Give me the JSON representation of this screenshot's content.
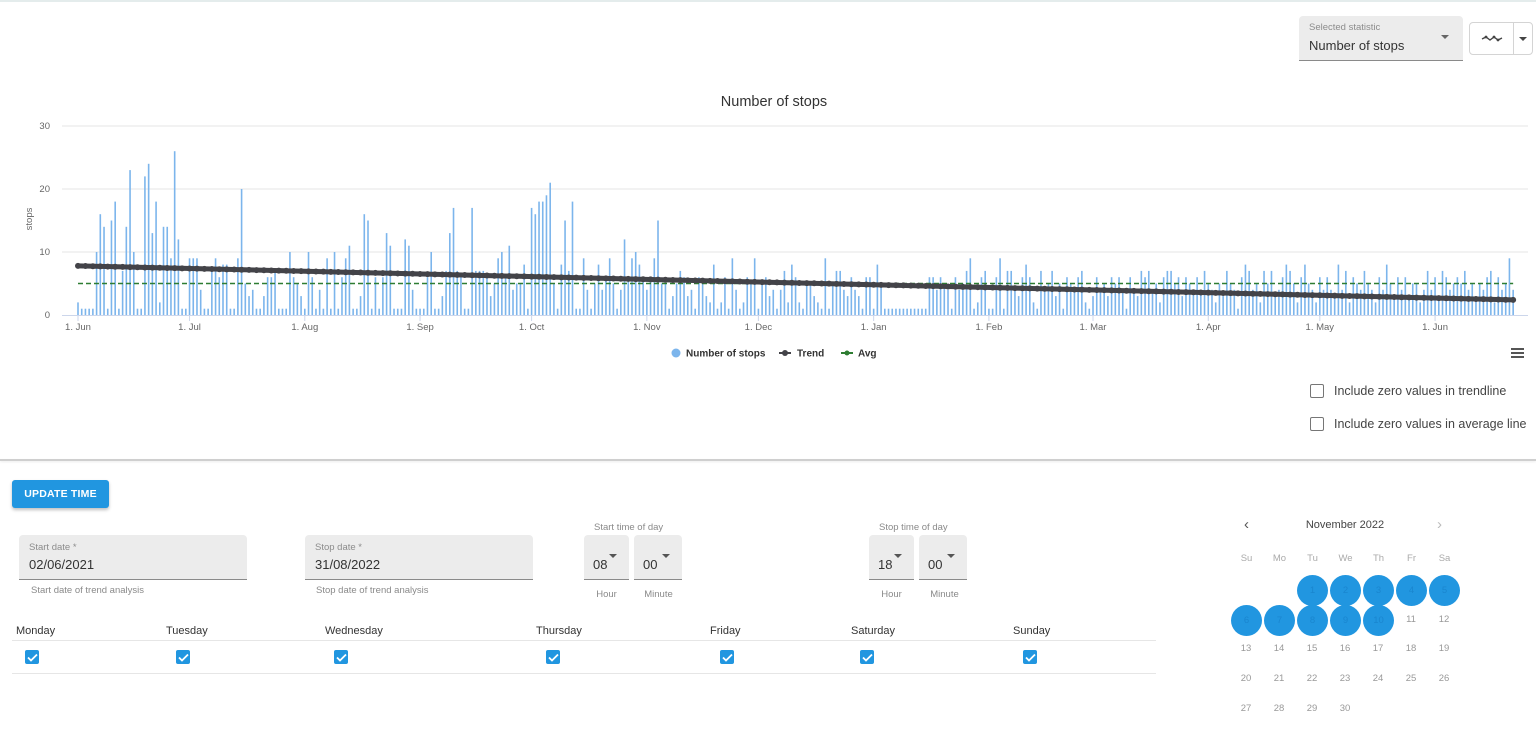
{
  "controls": {
    "statistic_select": {
      "label": "Selected statistic",
      "value": "Number of stops"
    },
    "chart_type_button": {
      "icon": "line-chart-icon"
    },
    "chart_type_dropdown": {
      "icon": "caret-down-icon"
    }
  },
  "chart_data": {
    "type": "bar",
    "title": "Number of stops",
    "xlabel": "",
    "ylabel": "stops",
    "ylim": [
      0,
      30
    ],
    "yticks": [
      0,
      10,
      20,
      30
    ],
    "grid": true,
    "x_start": "2021-06-01",
    "x_end": "2022-06-20",
    "xticks": [
      {
        "label": "1. Jun",
        "day": 0
      },
      {
        "label": "1. Jul",
        "day": 30
      },
      {
        "label": "1. Aug",
        "day": 61
      },
      {
        "label": "1. Sep",
        "day": 92
      },
      {
        "label": "1. Oct",
        "day": 122
      },
      {
        "label": "1. Nov",
        "day": 153
      },
      {
        "label": "1. Dec",
        "day": 183
      },
      {
        "label": "1. Jan",
        "day": 214
      },
      {
        "label": "1. Feb",
        "day": 245
      },
      {
        "label": "1. Mar",
        "day": 273
      },
      {
        "label": "1. Apr",
        "day": 304
      },
      {
        "label": "1. May",
        "day": 334
      },
      {
        "label": "1. Jun",
        "day": 365
      }
    ],
    "legend_position": "bottom-center",
    "series": [
      {
        "name": "Number of stops",
        "type": "bar",
        "color": "#7cb5ec",
        "values": [
          2,
          1,
          1,
          1,
          1,
          10,
          16,
          14,
          1,
          15,
          18,
          1,
          7,
          14,
          23,
          10,
          1,
          1,
          22,
          24,
          13,
          18,
          2,
          14,
          14,
          9,
          26,
          12,
          1,
          1,
          9,
          9,
          9,
          4,
          1,
          1,
          7,
          9,
          6,
          8,
          8,
          1,
          1,
          9,
          20,
          5,
          3,
          4,
          1,
          1,
          3,
          6,
          6,
          7,
          1,
          1,
          1,
          10,
          6,
          5,
          3,
          1,
          10,
          6,
          1,
          4,
          1,
          9,
          1,
          10,
          1,
          6,
          9,
          11,
          1,
          1,
          3,
          16,
          15,
          1,
          6,
          1,
          6,
          13,
          11,
          1,
          1,
          1,
          12,
          11,
          4,
          1,
          1,
          1,
          6,
          10,
          1,
          1,
          3,
          7,
          13,
          17,
          7,
          6,
          1,
          1,
          17,
          7,
          7,
          7,
          6,
          3,
          5,
          9,
          10,
          6,
          11,
          4,
          5,
          5,
          8,
          1,
          17,
          16,
          18,
          18,
          19,
          21,
          5,
          1,
          8,
          15,
          7,
          18,
          1,
          1,
          9,
          4,
          1,
          5,
          8,
          4,
          6,
          9,
          5,
          1,
          4,
          12,
          6,
          9,
          10,
          8,
          6,
          4,
          6,
          9,
          15,
          5,
          5,
          1,
          3,
          5,
          7,
          6,
          3,
          4,
          1,
          6,
          5,
          3,
          2,
          8,
          1,
          2,
          6,
          1,
          9,
          4,
          1,
          2,
          6,
          5,
          9,
          1,
          5,
          6,
          3,
          4,
          1,
          4,
          7,
          2,
          8,
          6,
          2,
          1,
          5,
          5,
          3,
          2,
          1,
          9,
          1,
          5,
          7,
          7,
          4,
          3,
          6,
          4,
          3,
          1,
          6,
          6,
          1,
          8,
          5,
          1,
          1,
          1,
          1,
          1,
          1,
          1,
          1,
          1,
          1,
          1,
          1,
          6,
          6,
          4,
          6,
          5,
          4,
          1,
          6,
          4,
          5,
          7,
          9,
          1,
          2,
          6,
          7,
          1,
          1,
          6,
          9,
          1,
          7,
          7,
          4,
          3,
          6,
          8,
          6,
          2,
          1,
          7,
          4,
          5,
          7,
          3,
          5,
          1,
          6,
          5,
          4,
          6,
          7,
          2,
          1,
          3,
          6,
          4,
          5,
          3,
          6,
          5,
          6,
          4,
          1,
          6,
          4,
          3,
          7,
          6,
          7,
          4,
          5,
          2,
          6,
          7,
          7,
          5,
          6,
          3,
          6,
          5,
          4,
          6,
          4,
          7,
          5,
          4,
          2,
          5,
          3,
          7,
          5,
          4,
          1,
          6,
          8,
          7,
          4,
          5,
          2,
          7,
          5,
          7,
          3,
          4,
          6,
          8,
          7,
          5,
          2,
          6,
          8,
          5,
          4,
          2,
          6,
          4,
          6,
          4,
          3,
          8,
          4,
          7,
          2,
          6,
          5,
          4,
          7,
          5,
          4,
          2,
          6,
          4,
          8,
          5,
          3,
          6,
          4,
          6,
          3,
          5,
          5,
          2,
          4,
          7,
          4,
          6,
          3,
          7,
          6,
          4,
          5,
          6,
          5,
          7,
          4,
          5,
          3,
          5,
          4,
          6,
          7,
          2,
          6,
          4,
          5,
          9,
          4
        ]
      },
      {
        "name": "Trend",
        "type": "line",
        "color": "#434348",
        "start_value": 7.8,
        "end_value": 2.4
      },
      {
        "name": "Avg",
        "type": "line",
        "color": "#2e7d32",
        "dash": "dashed",
        "value": 5
      }
    ]
  },
  "chart_menu": {
    "icon": "hamburger-menu-icon"
  },
  "options": [
    {
      "label": "Include zero values in trendline",
      "checked": false
    },
    {
      "label": "Include zero values in average line",
      "checked": false
    }
  ],
  "update_button": "UPDATE TIME",
  "start_date": {
    "label": "Start date *",
    "value": "02/06/2021",
    "hint": "Start date of trend analysis"
  },
  "stop_date": {
    "label": "Stop date *",
    "value": "31/08/2022",
    "hint": "Stop date of trend analysis"
  },
  "start_time": {
    "label": "Start time of day",
    "hour": "08",
    "minute": "00",
    "hour_label": "Hour",
    "minute_label": "Minute"
  },
  "stop_time": {
    "label": "Stop time of day",
    "hour": "18",
    "minute": "00",
    "hour_label": "Hour",
    "minute_label": "Minute"
  },
  "weekdays": [
    {
      "label": "Monday",
      "checked": true
    },
    {
      "label": "Tuesday",
      "checked": true
    },
    {
      "label": "Wednesday",
      "checked": true
    },
    {
      "label": "Thursday",
      "checked": true
    },
    {
      "label": "Friday",
      "checked": true
    },
    {
      "label": "Saturday",
      "checked": true
    },
    {
      "label": "Sunday",
      "checked": true
    }
  ],
  "calendar": {
    "title": "November 2022",
    "prev_icon": "chevron-left-icon",
    "next_icon": "chevron-right-icon",
    "day_headers": [
      "Su",
      "Mo",
      "Tu",
      "We",
      "Th",
      "Fr",
      "Sa"
    ],
    "first_weekday": 2,
    "days_in_month": 30,
    "selected_days": [
      1,
      2,
      3,
      4,
      5,
      6,
      7,
      8,
      9,
      10
    ],
    "accent": "#2196e0"
  }
}
